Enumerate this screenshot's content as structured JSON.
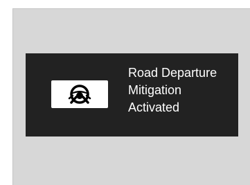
{
  "alert": {
    "icon": "road-departure-mitigation-icon",
    "message_lines": [
      "Road Departure",
      "Mitigation",
      "Activated"
    ]
  },
  "colors": {
    "panel_background": "#d7d7d7",
    "banner_background": "#222222",
    "icon_background": "#ffffff",
    "text": "#ffffff"
  }
}
